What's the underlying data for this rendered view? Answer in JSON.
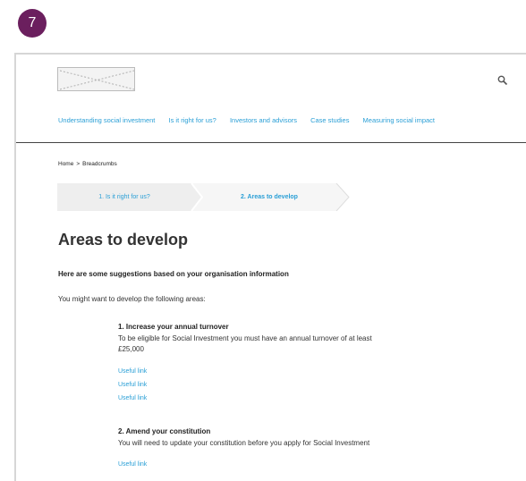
{
  "step_badge": "7",
  "header": {
    "logo_icon": "image-placeholder-icon",
    "search_icon": "search-icon"
  },
  "nav": {
    "items": [
      {
        "label": "Understanding social investment"
      },
      {
        "label": "Is it right for us?"
      },
      {
        "label": "Investors and advisors"
      },
      {
        "label": "Case studies"
      },
      {
        "label": "Measuring social impact"
      }
    ]
  },
  "breadcrumb": {
    "home": "Home",
    "separator": ">",
    "current": "Breadcrumbs"
  },
  "stepper": {
    "steps": [
      {
        "label": "1. Is it right for us?",
        "state": "completed"
      },
      {
        "label": "2. Areas to develop",
        "state": "active"
      }
    ]
  },
  "page": {
    "title": "Areas to develop",
    "intro_bold": "Here are some suggestions based on your organisation information",
    "intro": "You might want to develop the following areas:"
  },
  "areas": [
    {
      "title": "1. Increase your annual turnover",
      "description_line1": "To be eligible for Social Investment you must have an annual turnover of at least",
      "description_line2": "£25,000",
      "links": [
        "Useful link",
        "Useful link",
        "Useful link"
      ]
    },
    {
      "title": "2. Amend your constitution",
      "description_line1": "You will need to update your constitution before you apply for Social Investment",
      "links": [
        "Useful link"
      ]
    }
  ],
  "colors": {
    "badge": "#6b1f5e",
    "link": "#2a9fd6",
    "step_completed_bg": "#eeeeee",
    "step_active_bg": "#f6f6f6"
  }
}
